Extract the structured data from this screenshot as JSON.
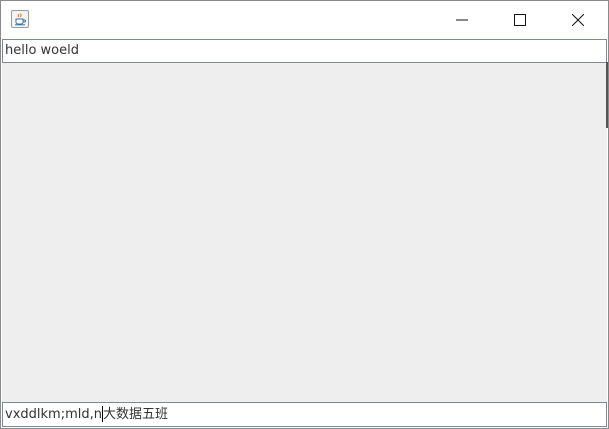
{
  "window": {
    "title": "",
    "icon": "java-coffee-cup-icon",
    "controls": {
      "minimize": "minimize-icon",
      "maximize": "maximize-icon",
      "close": "close-icon"
    }
  },
  "top_field": {
    "value": "hello woeld"
  },
  "bottom_field": {
    "value_before_caret": "vxddlkm;mld,n",
    "value_after_caret": "大数据五班"
  },
  "colors": {
    "content_background": "#eeeeee",
    "field_border": "#7a8a99",
    "text": "#333333"
  }
}
